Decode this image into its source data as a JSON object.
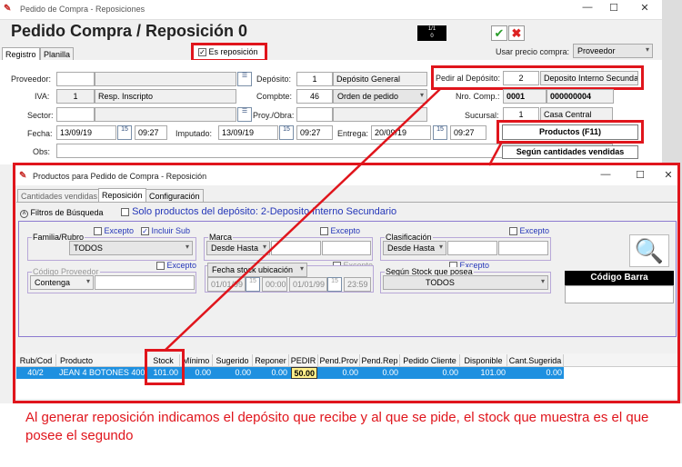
{
  "window": {
    "title": "Pedido de Compra - Reposiciones",
    "heading": "Pedido Compra / Reposición  0",
    "counter_top": "1/1",
    "counter_bottom": "0",
    "min": "—",
    "max": "☐",
    "close": "✕"
  },
  "tabs": [
    "Registro",
    "Planilla"
  ],
  "es_reposicion": "Es reposición",
  "usar_precio": {
    "label": "Usar precio compra:",
    "value": "Proveedor"
  },
  "form": {
    "proveedor_label": "Proveedor:",
    "iva_label": "IVA:",
    "iva_code": "1",
    "iva_value": "Resp. Inscripto",
    "sector_label": "Sector:",
    "fecha_label": "Fecha:",
    "fecha": "13/09/19",
    "fecha_time": "09:27",
    "imputado_label": "Imputado:",
    "imputado": "13/09/19",
    "imputado_time": "09:27",
    "entrega_label": "Entrega:",
    "entrega": "20/09/19",
    "entrega_time": "09:27",
    "obs_label": "Obs:",
    "deposito_label": "Depósito:",
    "deposito_code": "1",
    "deposito_value": "Depósito General",
    "compbte_label": "Compbte:",
    "compbte_code": "46",
    "compbte_value": "Orden de pedido",
    "proy_label": "Proy./Obra:",
    "pedir_label": "Pedir al Depósito:",
    "pedir_code": "2",
    "pedir_value": "Deposito Interno Secunda",
    "nro_label": "Nro. Comp.:",
    "nro_a": "0001",
    "nro_b": "000000004",
    "sucursal_label": "Sucursal:",
    "sucursal_code": "1",
    "sucursal_value": "Casa Central",
    "cal_icon": "15"
  },
  "productos_button": "Productos (F11)",
  "segun_button": "Según cantidades vendidas",
  "dialog": {
    "title": "Productos para Pedido de Compra - Reposición",
    "tabs": [
      "Cantidades vendidas",
      "Reposición",
      "Configuración"
    ],
    "filtros": "Filtros de Búsqueda",
    "solo": "Solo productos del depósito: 2-Deposito Interno Secundario",
    "excepto": "Excepto",
    "incluir_sub": "Incluir Sub",
    "familia": "Familia/Rubro",
    "familia_value": "TODOS",
    "marca": "Marca",
    "marca_value": "Desde Hasta",
    "clasif": "Clasificación",
    "clasif_value": "Desde Hasta",
    "codprov": "Código Proveedor",
    "codprov_value": "Contenga",
    "fechastock": "Fecha stock ubicación",
    "fs_date1": "01/01/99",
    "fs_time1": "00:00",
    "fs_date2": "01/01/99",
    "fs_time2": "23:59",
    "segunstock": "Según Stock que posea",
    "segunstock_value": "TODOS",
    "codbarra": "Código Barra",
    "columns": [
      "Rub/Cod",
      "Producto",
      "Stock",
      "Mínimo",
      "Sugerido",
      "Reponer",
      "PEDIR",
      "Pend.Prov",
      "Pend.Rep",
      "Pedido Cliente",
      "Disponible",
      "Cant.Sugerida"
    ],
    "row": [
      "40/2",
      "JEAN 4 BOTONES 400A",
      "101.00",
      "0.00",
      "0.00",
      "0.00",
      "50.00",
      "0.00",
      "0.00",
      "0.00",
      "101.00",
      "0.00"
    ]
  },
  "annotation": "Al generar reposición indicamos el depósito que recibe y al que se pide, el stock que muestra es el que posee el segundo",
  "colors": {
    "annotation": "#e0151c",
    "selection": "#1e90e0"
  }
}
